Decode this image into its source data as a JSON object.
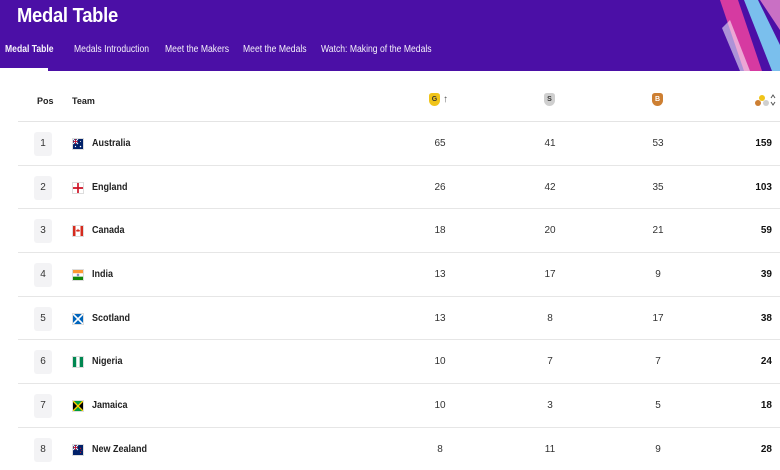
{
  "header": {
    "title": "Medal Table",
    "nav": [
      {
        "label": "Medal Table",
        "active": true
      },
      {
        "label": "Medals Introduction",
        "active": false
      },
      {
        "label": "Meet the Makers",
        "active": false
      },
      {
        "label": "Meet the Medals",
        "active": false
      },
      {
        "label": "Watch: Making of the Medals",
        "active": false
      }
    ],
    "background_color": "#4b0fa6"
  },
  "table": {
    "columns": {
      "pos": "Pos",
      "team": "Team",
      "gold": "G",
      "silver": "S",
      "bronze": "B"
    },
    "sort_icon": "arrow-up-icon",
    "total_icon": "medals-total-icon",
    "total_sort_icon": "sort-toggle-icon",
    "rows": [
      {
        "pos": "1",
        "team": "Australia",
        "flag": "australia-flag-icon",
        "gold": "65",
        "silver": "41",
        "bronze": "53",
        "total": "159"
      },
      {
        "pos": "2",
        "team": "England",
        "flag": "england-flag-icon",
        "gold": "26",
        "silver": "42",
        "bronze": "35",
        "total": "103"
      },
      {
        "pos": "3",
        "team": "Canada",
        "flag": "canada-flag-icon",
        "gold": "18",
        "silver": "20",
        "bronze": "21",
        "total": "59"
      },
      {
        "pos": "4",
        "team": "India",
        "flag": "india-flag-icon",
        "gold": "13",
        "silver": "17",
        "bronze": "9",
        "total": "39"
      },
      {
        "pos": "5",
        "team": "Scotland",
        "flag": "scotland-flag-icon",
        "gold": "13",
        "silver": "8",
        "bronze": "17",
        "total": "38"
      },
      {
        "pos": "6",
        "team": "Nigeria",
        "flag": "nigeria-flag-icon",
        "gold": "10",
        "silver": "7",
        "bronze": "7",
        "total": "24"
      },
      {
        "pos": "7",
        "team": "Jamaica",
        "flag": "jamaica-flag-icon",
        "gold": "10",
        "silver": "3",
        "bronze": "5",
        "total": "18"
      },
      {
        "pos": "8",
        "team": "New Zealand",
        "flag": "new-zealand-flag-icon",
        "gold": "8",
        "silver": "11",
        "bronze": "9",
        "total": "28"
      }
    ]
  }
}
